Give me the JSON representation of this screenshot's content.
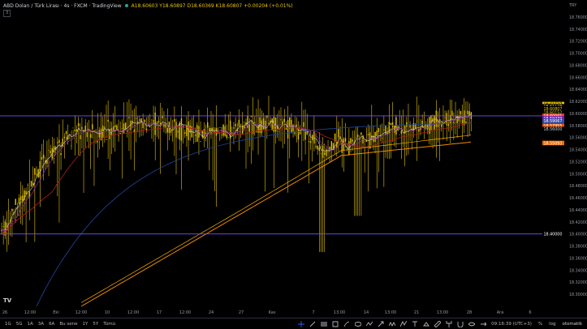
{
  "header": {
    "title": "ABD Doları / Türk Lirası · 4s · FXCM · TradingView",
    "ohlc": "A18.60603  Y18.60897  D18.60369  K18.60807  +0.00204 (+0.01%)",
    "sub": "3"
  },
  "chart_data": {
    "type": "candlestick",
    "currency": "TRY",
    "ylim": [
      18.28,
      18.78
    ],
    "yticks": [
      "18.76000",
      "18.74000",
      "18.72000",
      "18.70000",
      "18.68000",
      "18.66000",
      "18.64000",
      "18.62000",
      "18.60000",
      "18.58000",
      "18.56000",
      "18.54000",
      "18.52000",
      "18.50000",
      "18.48000",
      "18.46000",
      "18.44000",
      "18.42000",
      "18.40000",
      "18.38000",
      "18.36000",
      "18.34000",
      "18.32000",
      "18.30000"
    ],
    "xticks": [
      {
        "label": "26",
        "x": 6
      },
      {
        "label": "12:00",
        "x": 37
      },
      {
        "label": "Eki",
        "x": 69
      },
      {
        "label": "12:00",
        "x": 100
      },
      {
        "label": "10",
        "x": 132
      },
      {
        "label": "12:00",
        "x": 164
      },
      {
        "label": "17",
        "x": 196
      },
      {
        "label": "12:00",
        "x": 228
      },
      {
        "label": "24",
        "x": 260
      },
      {
        "label": "27",
        "x": 297
      },
      {
        "label": "Kas",
        "x": 335
      },
      {
        "label": "7",
        "x": 386
      },
      {
        "label": "13:00",
        "x": 418
      },
      {
        "label": "14",
        "x": 451
      },
      {
        "label": "13:00",
        "x": 481
      },
      {
        "label": "21",
        "x": 513
      },
      {
        "label": "13:00",
        "x": 545
      },
      {
        "label": "28",
        "x": 578
      },
      {
        "label": "Ara",
        "x": 616
      },
      {
        "label": "6",
        "x": 653
      }
    ],
    "horizontal_lines": [
      18.596,
      18.4
    ],
    "price_labels": [
      {
        "value": "18.61537",
        "price": 18.6154,
        "bg": "#e6c400",
        "fg": "#000"
      },
      {
        "value": "18.61178",
        "price": 18.6118,
        "bg": "#000",
        "fg": "#e6c400"
      },
      {
        "value": "18.60807",
        "price": 18.6081,
        "bg": "#000",
        "fg": "#e6c400"
      },
      {
        "value": "18.60152",
        "price": 18.6015,
        "bg": "#000",
        "fg": "#e6c400"
      },
      {
        "value": "18.60001",
        "price": 18.596,
        "bg": "#e53935",
        "fg": "#fff"
      },
      {
        "value": "18.59439",
        "price": 18.592,
        "bg": "#7b1fa2",
        "fg": "#fff"
      },
      {
        "value": "18.59067",
        "price": 18.5878,
        "bg": "#3949ab",
        "fg": "#fff"
      },
      {
        "value": "18.57955",
        "price": 18.5796,
        "bg": "#e65100",
        "fg": "#fff"
      },
      {
        "value": "18.56000",
        "price": 18.574,
        "bg": "#000",
        "fg": "#d1d4dc"
      },
      {
        "value": "18.55093",
        "price": 18.5509,
        "bg": "#ef6c00",
        "fg": "#fff"
      },
      {
        "value": "18.40000",
        "price": 18.4,
        "bg": "#000",
        "fg": "#fff"
      }
    ],
    "colors": {
      "candles": "#e6c400",
      "ma_fast": "#c8c8c8",
      "ma_mid": "#8e24aa",
      "ma_red": "#b71c1c",
      "ma_blue": "#1e3f8f",
      "ma_orange": "#ef8a00",
      "hline": "#7c4dff"
    }
  },
  "toolbar": {
    "timeframes": [
      "1G",
      "5G",
      "1A",
      "3A",
      "6A",
      "Bu sene",
      "1Y",
      "5Y",
      "Tümü"
    ],
    "tools": [
      "crosshair-icon",
      "line-icon",
      "fib-icon",
      "rect-icon",
      "brush-icon",
      "ellipse-icon",
      "path-icon",
      "arrow-icon",
      "zigzag-icon",
      "pattern-icon",
      "text-icon",
      "measure-icon",
      "ruler-icon",
      "pitchfork-icon",
      "magnet-icon",
      "eye-icon",
      "ray-icon"
    ],
    "time": "09:16:39 (UTC+3)",
    "pct": "%",
    "log": "log",
    "auto": "otomatik"
  }
}
